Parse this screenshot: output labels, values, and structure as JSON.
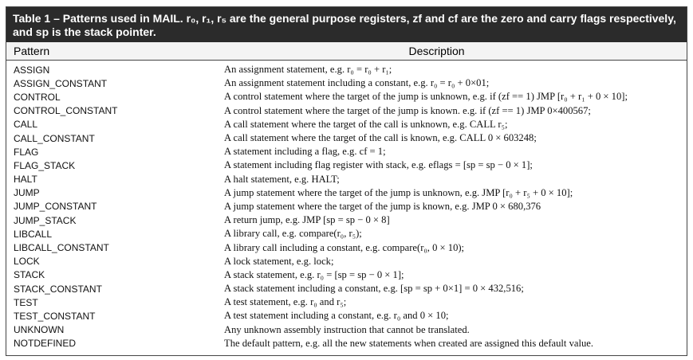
{
  "caption": {
    "text": "Table 1 – Patterns used in MAIL. r₀, r₁, r₅ are the general purpose registers, zf and cf are the zero and carry flags respectively, and sp is the stack pointer."
  },
  "header": {
    "pattern": "Pattern",
    "description": "Description"
  },
  "rows": [
    {
      "pattern": "ASSIGN",
      "description": "An assignment statement, e.g. r₀ = r₀ + r₁;"
    },
    {
      "pattern": "ASSIGN_CONSTANT",
      "description": "An assignment statement including a constant, e.g. r₀ = r₀ + 0×01;"
    },
    {
      "pattern": "CONTROL",
      "description": "A control statement where the target of the jump is unknown, e.g. if (zf == 1) JMP [r₀ + r₁ + 0 × 10];"
    },
    {
      "pattern": "CONTROL_CONSTANT",
      "description": "A control statement where the target of the jump is known. e.g. if (zf == 1) JMP 0×400567;"
    },
    {
      "pattern": "CALL",
      "description": "A call statement where the target of the call is unknown, e.g. CALL r₅;"
    },
    {
      "pattern": "CALL_CONSTANT",
      "description": "A call statement where the target of the call is known, e.g. CALL 0 × 603248;"
    },
    {
      "pattern": "FLAG",
      "description": "A statement including a flag, e.g. cf = 1;"
    },
    {
      "pattern": "FLAG_STACK",
      "description": "A statement including flag register with stack, e.g. eflags = [sp = sp − 0 × 1];"
    },
    {
      "pattern": "HALT",
      "description": "A halt statement, e.g. HALT;"
    },
    {
      "pattern": "JUMP",
      "description": "A jump statement where the target of the jump is unknown, e.g. JMP [r₀ + r₅ + 0 × 10];"
    },
    {
      "pattern": "JUMP_CONSTANT",
      "description": "A jump statement where the target of the jump is known, e.g. JMP 0 × 680,376"
    },
    {
      "pattern": "JUMP_STACK",
      "description": "A return jump, e.g. JMP [sp = sp − 0 × 8]"
    },
    {
      "pattern": "LIBCALL",
      "description": "A library call, e.g. compare(r₀, r₅);"
    },
    {
      "pattern": "LIBCALL_CONSTANT",
      "description": "A library call including a constant, e.g. compare(r₀, 0 × 10);"
    },
    {
      "pattern": "LOCK",
      "description": "A lock statement, e.g. lock;"
    },
    {
      "pattern": "STACK",
      "description": "A stack statement, e.g. r₀ = [sp = sp − 0 × 1];"
    },
    {
      "pattern": "STACK_CONSTANT",
      "description": "A stack statement including a constant, e.g. [sp = sp + 0×1] = 0 × 432,516;"
    },
    {
      "pattern": "TEST",
      "description": "A test statement, e.g. r₀ and r₅;"
    },
    {
      "pattern": "TEST_CONSTANT",
      "description": "A test statement including a constant, e.g. r₀ and 0 × 10;"
    },
    {
      "pattern": "UNKNOWN",
      "description": "Any unknown assembly instruction that cannot be translated."
    },
    {
      "pattern": "NOTDEFINED",
      "description": "The default pattern, e.g. all the new statements when created are assigned this default value."
    }
  ]
}
